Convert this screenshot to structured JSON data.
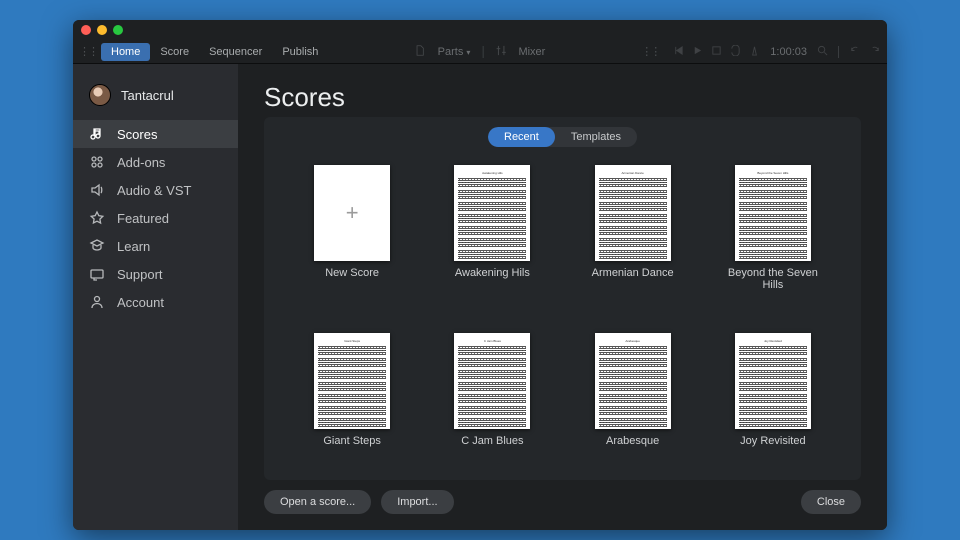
{
  "menubar": {
    "items": [
      "Home",
      "Score",
      "Sequencer",
      "Publish"
    ],
    "active_index": 0,
    "center": {
      "parts": "Parts",
      "mixer": "Mixer"
    },
    "timecode": "1:00:03"
  },
  "sidebar": {
    "username": "Tantacrul",
    "items": [
      {
        "icon": "music",
        "label": "Scores"
      },
      {
        "icon": "addons",
        "label": "Add-ons"
      },
      {
        "icon": "audio",
        "label": "Audio & VST"
      },
      {
        "icon": "star",
        "label": "Featured"
      },
      {
        "icon": "learn",
        "label": "Learn"
      },
      {
        "icon": "support",
        "label": "Support"
      },
      {
        "icon": "account",
        "label": "Account"
      }
    ],
    "active_index": 0
  },
  "page": {
    "title": "Scores",
    "tabs": [
      "Recent",
      "Templates"
    ],
    "active_tab": 0
  },
  "scores": [
    {
      "type": "new",
      "label": "New Score"
    },
    {
      "type": "doc",
      "label": "Awakening Hils"
    },
    {
      "type": "doc",
      "label": "Armenian Dance"
    },
    {
      "type": "doc",
      "label": "Beyond the Seven Hills"
    },
    {
      "type": "doc",
      "label": "Giant Steps"
    },
    {
      "type": "doc",
      "label": "C Jam Blues"
    },
    {
      "type": "doc",
      "label": "Arabesque"
    },
    {
      "type": "doc",
      "label": "Joy Revisited"
    }
  ],
  "footer": {
    "open": "Open a score...",
    "import": "Import...",
    "close": "Close"
  }
}
